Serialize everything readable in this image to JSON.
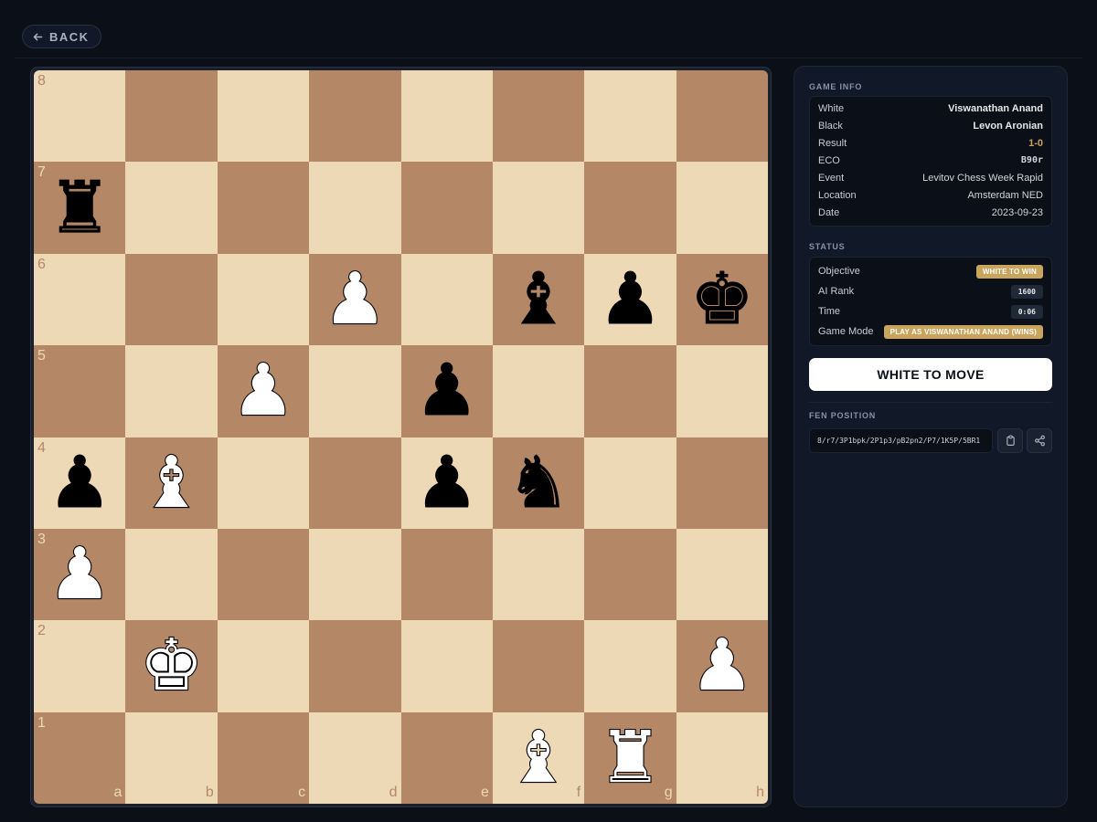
{
  "nav": {
    "back_label": "BACK"
  },
  "board": {
    "ranks": [
      "8",
      "7",
      "6",
      "5",
      "4",
      "3",
      "2",
      "1"
    ],
    "files": [
      "a",
      "b",
      "c",
      "d",
      "e",
      "f",
      "g",
      "h"
    ],
    "squares": [
      [
        "",
        "",
        "",
        "",
        "",
        "",
        "",
        ""
      ],
      [
        "r",
        "",
        "",
        "",
        "",
        "",
        "",
        ""
      ],
      [
        "",
        "",
        "",
        "P",
        "",
        "b",
        "p",
        "k"
      ],
      [
        "",
        "",
        "P",
        "",
        "p",
        "",
        "",
        ""
      ],
      [
        "p",
        "B",
        "",
        "",
        "p",
        "n",
        "",
        ""
      ],
      [
        "P",
        "",
        "",
        "",
        "",
        "",
        "",
        ""
      ],
      [
        "",
        "K",
        "",
        "",
        "",
        "",
        "",
        "P"
      ],
      [
        "",
        "",
        "",
        "",
        "",
        "B",
        "R",
        ""
      ]
    ],
    "glyphs": {
      "K": "♚",
      "Q": "♛",
      "R": "♜",
      "B": "♝",
      "N": "♞",
      "P": "♟",
      "k": "♚",
      "q": "♛",
      "r": "♜",
      "b": "♝",
      "n": "♞",
      "p": "♟"
    },
    "colors": {
      "light": "#eed9b6",
      "dark": "#b48866"
    }
  },
  "game_info": {
    "title": "GAME INFO",
    "rows": [
      {
        "key": "White",
        "value": "Viswanathan Anand"
      },
      {
        "key": "Black",
        "value": "Levon Aronian"
      },
      {
        "key": "Result",
        "value": "1-0"
      },
      {
        "key": "ECO",
        "value": "B90r"
      },
      {
        "key": "Event",
        "value": "Levitov Chess Week Rapid"
      },
      {
        "key": "Location",
        "value": "Amsterdam NED"
      },
      {
        "key": "Date",
        "value": "2023-09-23"
      }
    ]
  },
  "status": {
    "title": "STATUS",
    "objective_label": "Objective",
    "objective_value": "WHITE TO WIN",
    "rank_label": "AI Rank",
    "rank_value": "1600",
    "time_label": "Time",
    "time_value": "0:06",
    "mode_label": "Game Mode",
    "mode_value": "PLAY AS VISWANATHAN ANAND (WINS)"
  },
  "turn_label": "WHITE TO MOVE",
  "fen": {
    "title": "FEN POSITION",
    "value": "8/r7/3P1bpk/2P1p3/pB2pn2/P7/1K5P/5BR1"
  },
  "accent_color": "#c9a45c"
}
